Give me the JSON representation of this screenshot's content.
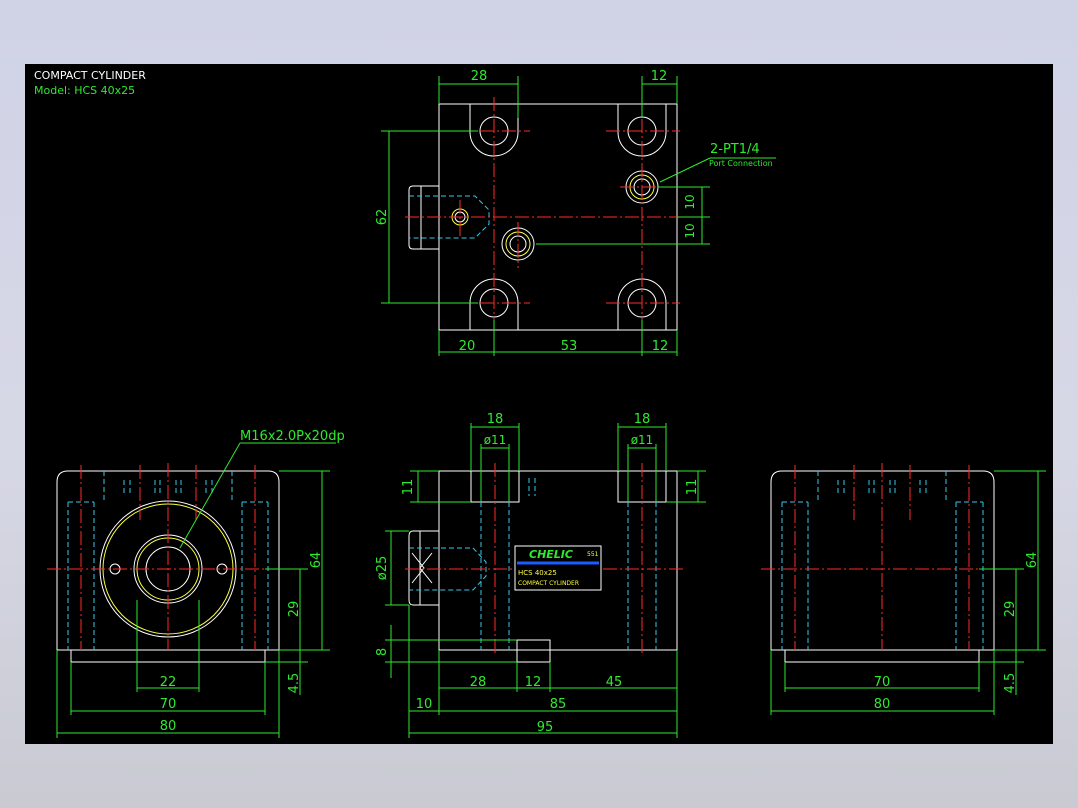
{
  "title_block": {
    "title": "COMPACT CYLINDER",
    "model": "Model:  HCS 40x25"
  },
  "top_view": {
    "dims": {
      "top_left": "28",
      "top_right": "12",
      "height": "62",
      "bottom_left": "20",
      "bottom_mid": "53",
      "bottom_right": "12",
      "port_offset_1": "10",
      "port_offset_2": "10"
    },
    "port_callout": "2-PT1/4",
    "port_callout_sub": "Port Connection"
  },
  "left_view": {
    "thread_callout": "M16x2.0Px20dp",
    "dims": {
      "height": "64",
      "center": "29",
      "base": "4.5",
      "bore": "22",
      "pitch": "70",
      "width": "80"
    }
  },
  "front_view": {
    "dims": {
      "cb_left": "18",
      "cb_right": "18",
      "hole_left": "ø11",
      "hole_right": "ø11",
      "cb_depth_left": "11",
      "cb_depth_right": "11",
      "rod_dia": "ø25",
      "key": "8",
      "seg_a": "28",
      "seg_b": "12",
      "seg_c": "45",
      "rod_len": "10",
      "body_len": "85",
      "total_len": "95"
    },
    "label": {
      "brand": "CHELIC",
      "code": "551",
      "line1": "HCS 40x25",
      "line2": "COMPACT CYLINDER"
    }
  },
  "right_view": {
    "dims": {
      "height": "64",
      "center": "29",
      "base": "4.5",
      "pitch": "70",
      "width": "80"
    }
  },
  "colors": {
    "outline": "#ffffff",
    "dimension": "#2eea2e",
    "centerline": "#ff2a2a",
    "hidden": "#38c8e6",
    "yellow": "#ffff40",
    "label_brand": "#2eea2e",
    "label_stripe": "#1a5cff"
  }
}
